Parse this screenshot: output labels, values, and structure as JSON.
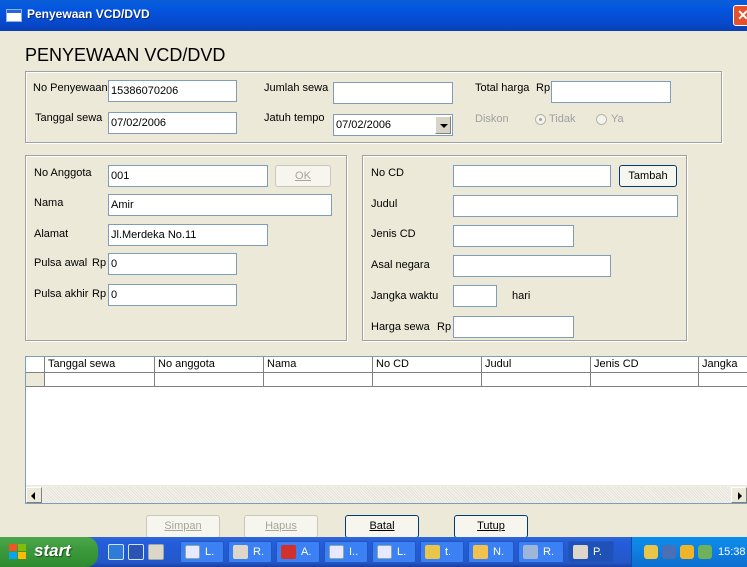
{
  "window": {
    "title": "Penyewaan VCD/DVD",
    "close_glyph": "✕"
  },
  "heading": "PENYEWAAN VCD/DVD",
  "top_form": {
    "no_penyewaan": {
      "label": "No Penyewaan",
      "value": "15386070206"
    },
    "tanggal_sewa": {
      "label": "Tanggal sewa",
      "value": "07/02/2006"
    },
    "jumlah_sewa": {
      "label": "Jumlah sewa",
      "value": ""
    },
    "jatuh_tempo": {
      "label": "Jatuh tempo",
      "value": "07/02/2006"
    },
    "total_harga": {
      "label": "Total harga",
      "currency": "Rp",
      "value": ""
    },
    "diskon": {
      "label": "Diskon",
      "options": [
        "Tidak",
        "Ya"
      ],
      "selected": "Tidak"
    }
  },
  "member_form": {
    "no_anggota": {
      "label": "No Anggota",
      "value": "001"
    },
    "ok_button": "OK",
    "nama": {
      "label": "Nama",
      "value": "Amir"
    },
    "alamat": {
      "label": "Alamat",
      "value": "Jl.Merdeka No.11"
    },
    "pulsa_awal": {
      "label": "Pulsa awal",
      "currency": "Rp",
      "value": "0"
    },
    "pulsa_akhir": {
      "label": "Pulsa akhir",
      "currency": "Rp",
      "value": "0"
    }
  },
  "cd_form": {
    "no_cd": {
      "label": "No CD",
      "value": ""
    },
    "tambah_button": "Tambah",
    "judul": {
      "label": "Judul",
      "value": ""
    },
    "jenis_cd": {
      "label": "Jenis CD",
      "value": ""
    },
    "asal_negara": {
      "label": "Asal negara",
      "value": ""
    },
    "jangka_waktu": {
      "label": "Jangka waktu",
      "value": "",
      "unit": "hari"
    },
    "harga_sewa": {
      "label": "Harga sewa",
      "currency": "Rp",
      "value": ""
    }
  },
  "grid": {
    "columns": [
      "Tanggal sewa",
      "No anggota",
      "Nama",
      "No CD",
      "Judul",
      "Jenis CD",
      "Jangka"
    ]
  },
  "buttons": {
    "simpan": "Simpan",
    "hapus": "Hapus",
    "batal": "Batal",
    "tutup": "Tutup"
  },
  "taskbar": {
    "start_label": "start",
    "tasks": [
      {
        "label": "L.",
        "icon": "word-icon"
      },
      {
        "label": "R.",
        "icon": "hand-icon"
      },
      {
        "label": "A.",
        "icon": "acrobat-icon"
      },
      {
        "label": "I..",
        "icon": "word-icon"
      },
      {
        "label": "L.",
        "icon": "word-icon"
      },
      {
        "label": "t.",
        "icon": "app-icon"
      },
      {
        "label": "N.",
        "icon": "folder-icon"
      },
      {
        "label": "R.",
        "icon": "app-icon"
      },
      {
        "label": "P.",
        "icon": "hand-icon"
      }
    ],
    "clock": "15:38"
  },
  "colors": {
    "titlebar": "#0355E0",
    "window_bg": "#ECE9D8",
    "start": "#3C9B3C",
    "taskbar": "#245EDC",
    "tray": "#0F7EE0"
  }
}
